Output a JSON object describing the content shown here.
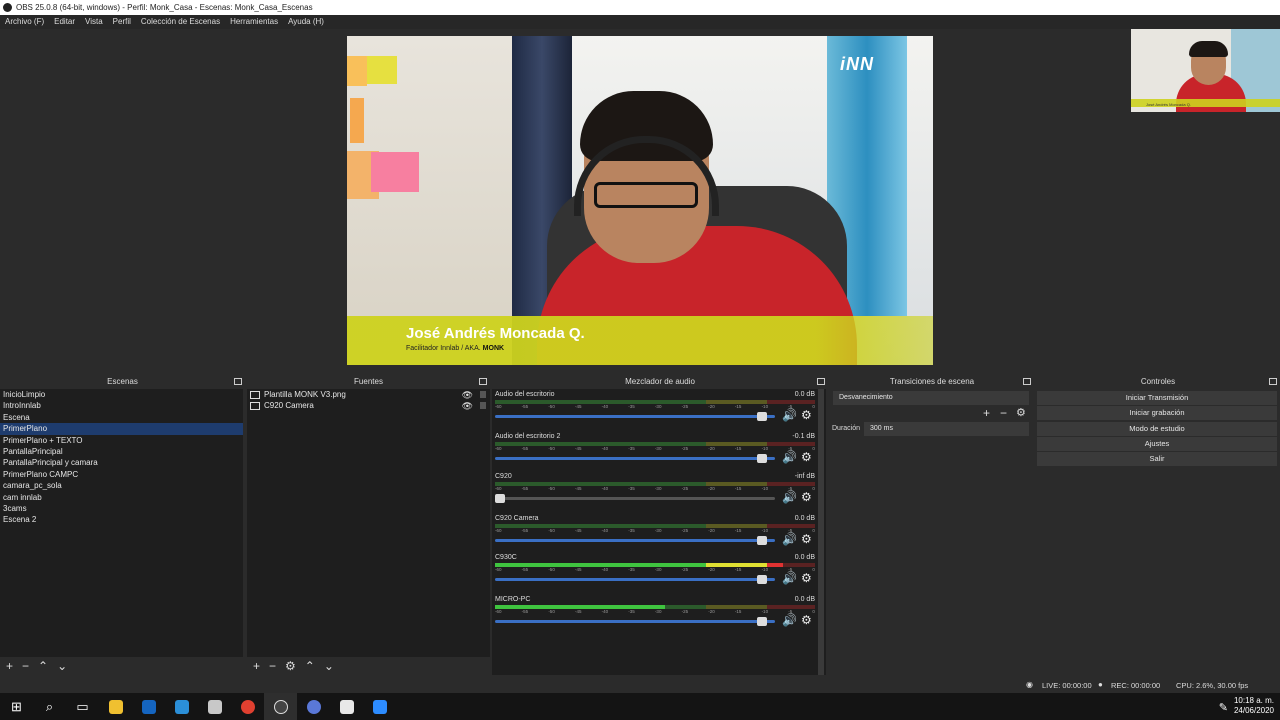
{
  "window": {
    "title": "OBS 25.0.8 (64-bit, windows) - Perfil: Monk_Casa - Escenas: Monk_Casa_Escenas"
  },
  "menu": [
    "Archivo (F)",
    "Editar",
    "Vista",
    "Perfil",
    "Colección de Escenas",
    "Herramientas",
    "Ayuda (H)"
  ],
  "preview": {
    "lower_third_name": "José Andrés Moncada Q.",
    "lower_third_sub": "Facilitador Innlab / AKA.",
    "lower_third_sub_bold": "MONK",
    "logo_text": "iNN",
    "pip_name": "José Andrés Moncada Q."
  },
  "docks": {
    "scenes_title": "Escenas",
    "sources_title": "Fuentes",
    "mixer_title": "Mezclador de audio",
    "transitions_title": "Transiciones de escena",
    "controls_title": "Controles"
  },
  "scenes": [
    "InicioLimpio",
    "IntroInnlab",
    "Escena",
    "PrimerPlano",
    "PrimerPlano + TEXTO",
    "PantallaPrincipal",
    "PantallaPrincipal y camara",
    "PrimerPlano CAMPC",
    "camara_pc_sola",
    "cam innlab",
    "3cams",
    "Escena 2"
  ],
  "selected_scene_index": 3,
  "sources": [
    "Plantilla MONK V3.png",
    "C920 Camera"
  ],
  "mixer": [
    {
      "name": "Audio del escritorio",
      "db": "0.0 dB",
      "level": 0.0,
      "volume": 0.97
    },
    {
      "name": "Audio del escritorio 2",
      "db": "-0.1 dB",
      "level": 0.0,
      "volume": 0.97
    },
    {
      "name": "C920",
      "db": "-inf dB",
      "level": 0.0,
      "volume": 0.0
    },
    {
      "name": "C920 Camera",
      "db": "0.0 dB",
      "level": 0.0,
      "volume": 0.97
    },
    {
      "name": "C930C",
      "db": "0.0 dB",
      "level": 0.9,
      "volume": 0.97
    },
    {
      "name": "MICRO-PC",
      "db": "0.0 dB",
      "level": 0.53,
      "volume": 0.97
    }
  ],
  "meter_ticks": [
    "-60",
    "-55",
    "-50",
    "-45",
    "-40",
    "-35",
    "-30",
    "-25",
    "-20",
    "-15",
    "-10",
    "-5",
    "0"
  ],
  "transitions": {
    "type": "Desvanecimiento",
    "duration_label": "Duración",
    "duration_value": "300 ms"
  },
  "controls": [
    "Iniciar Transmisión",
    "Iniciar grabación",
    "Modo de estudio",
    "Ajustes",
    "Salir"
  ],
  "status": {
    "live": "LIVE: 00:00:00",
    "rec": "REC: 00:00:00",
    "cpu": "CPU: 2.6%, 30.00 fps"
  },
  "clock": {
    "time": "10:18 a. m.",
    "date": "24/06/2020"
  },
  "colors": {
    "selection": "#1e3c6e",
    "lower_third": "#cdd21e",
    "fader": "#3a6fc4",
    "meter_green": "#3fc43f"
  }
}
